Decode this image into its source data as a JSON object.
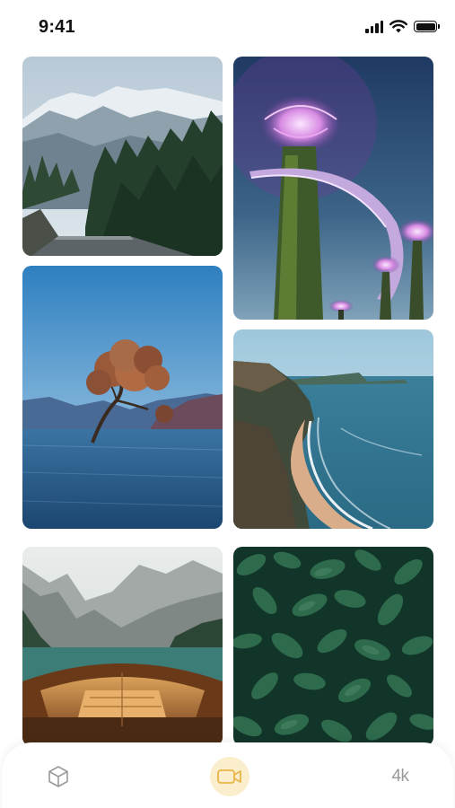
{
  "status_bar": {
    "time": "9:41",
    "icons": [
      "cellular-signal-icon",
      "wifi-icon",
      "battery-icon"
    ]
  },
  "gallery": {
    "photos": [
      {
        "subject": "mountain-road",
        "column": "left"
      },
      {
        "subject": "supertree-grove-night",
        "column": "right"
      },
      {
        "subject": "lone-tree-in-lake",
        "column": "left"
      },
      {
        "subject": "coastline-beach",
        "column": "right"
      },
      {
        "subject": "boat-on-mountain-lake",
        "column": "left"
      },
      {
        "subject": "green-leaves",
        "column": "right"
      }
    ]
  },
  "tab_bar": {
    "items": [
      {
        "icon": "cube-icon",
        "active": false
      },
      {
        "icon": "video-camera-icon",
        "active": true
      },
      {
        "label": "4k",
        "active": false
      }
    ],
    "colors": {
      "active_bg": "#fbeecd",
      "active_icon": "#e9b548",
      "inactive_icon": "#9a9a9a"
    }
  }
}
